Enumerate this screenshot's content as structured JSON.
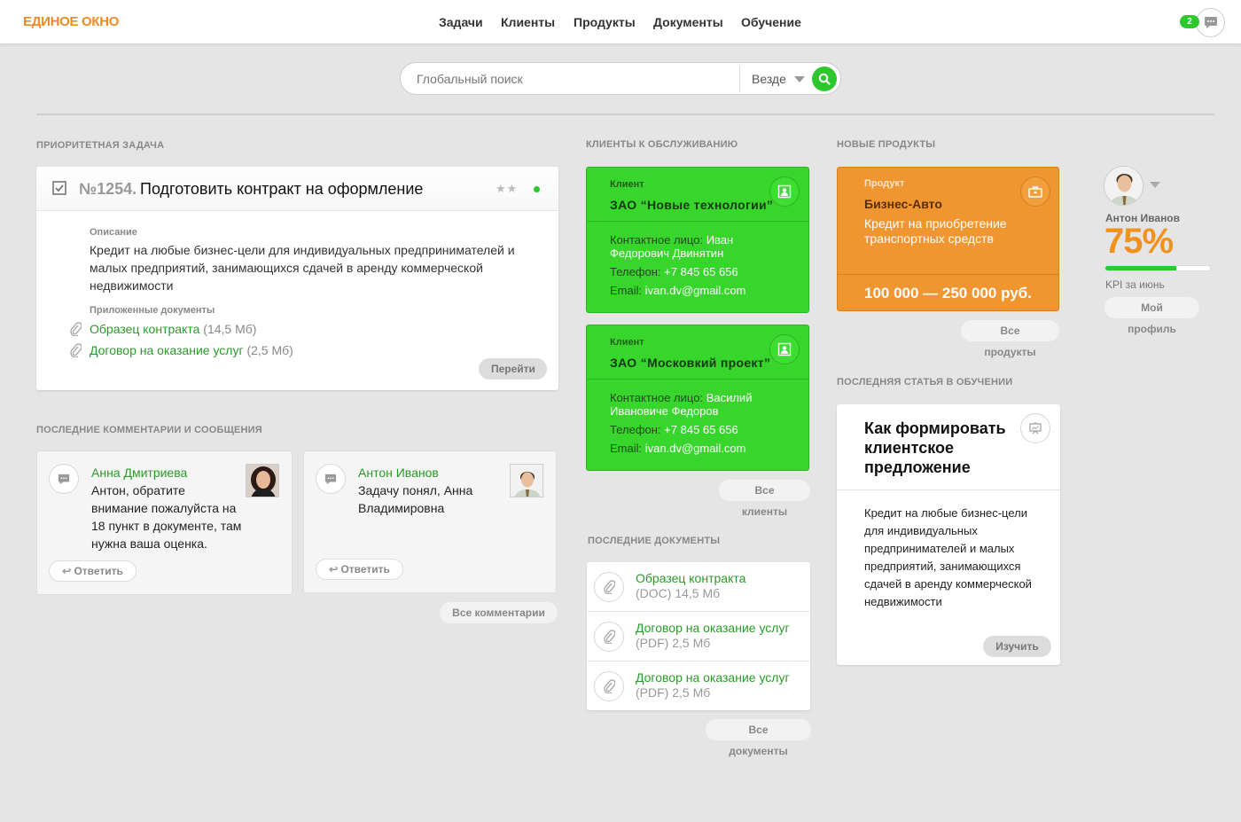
{
  "header": {
    "logo": "ЕДИНОЕ ОКНО",
    "nav": [
      "Задачи",
      "Клиенты",
      "Продукты",
      "Документы",
      "Обучение"
    ],
    "messages_count": "2"
  },
  "search": {
    "placeholder": "Глобальный поиск",
    "scope": "Везде"
  },
  "priority": {
    "section_title": "ПРИОРИТЕТНАЯ ЗАДАЧА",
    "number": "№1254.",
    "title": "Подготовить контракт на оформление",
    "desc_label": "Описание",
    "description": "Кредит на любые бизнес-цели для индивидуальных предпринимателей и малых предприятий, занимающихся сдачей в аренду коммерческой недвижимости",
    "docs_label": "Приложенные документы",
    "docs": [
      {
        "name": "Образец контракта",
        "size": "(14,5 Мб)"
      },
      {
        "name": "Договор на оказание услуг",
        "size": "(2,5 Мб)"
      }
    ],
    "go_button": "Перейти"
  },
  "comments": {
    "section_title": "ПОСЛЕДНИЕ КОММЕНТАРИИ И СООБЩЕНИЯ",
    "items": [
      {
        "author": "Анна Дмитриева",
        "text": "Антон, обратите внимание пожалуйста на 18 пункт в документе, там нужна ваша оценка.",
        "reply": "Ответить"
      },
      {
        "author": "Антон Иванов",
        "text": "Задачу понял, Анна Владимировна",
        "reply": "Ответить"
      }
    ],
    "all_button": "Все комментарии"
  },
  "clients": {
    "section_title": "КЛИЕНТЫ К ОБСЛУЖИВАНИЮ",
    "items": [
      {
        "label": "Клиент",
        "name": "ЗАО “Новые технологии”",
        "contact_label": "Контактное лицо:",
        "contact": "Иван Федорович Двинятин",
        "phone_label": "Телефон:",
        "phone": "+7 845 65 656",
        "email_label": "Email:",
        "email": "ivan.dv@gmail.com"
      },
      {
        "label": "Клиент",
        "name": "ЗАО “Московкий проект”",
        "contact_label": "Контактное лицо:",
        "contact": "Василий Ивановиче Федоров",
        "phone_label": "Телефон:",
        "phone": "+7 845 65 656",
        "email_label": "Email:",
        "email": "ivan.dv@gmail.com"
      }
    ],
    "all_button": "Все клиенты"
  },
  "documents": {
    "section_title": "ПОСЛЕДНИЕ ДОКУМЕНТЫ",
    "items": [
      {
        "name": "Образец контракта",
        "meta": "(DOC) 14,5 Мб"
      },
      {
        "name": "Договор на оказание услуг",
        "meta": "(PDF) 2,5 Мб"
      },
      {
        "name": "Договор на оказание услуг",
        "meta": "(PDF) 2,5 Мб"
      }
    ],
    "all_button": "Все документы"
  },
  "products": {
    "section_title": "НОВЫЕ ПРОДУКТЫ",
    "label": "Продукт",
    "name": "Бизнес-Авто",
    "description": "Кредит на приобретение транспортных средств",
    "price": "100 000 — 250 000 руб.",
    "all_button": "Все продукты"
  },
  "article": {
    "section_title": "ПОСЛЕДНЯЯ СТАТЬЯ В ОБУЧЕНИИ",
    "title": "Как формировать клиентское предложение",
    "text": "Кредит на любые бизнес-цели для индивидуальных предпринимателей и малых предприятий, занимающихся сдачей в аренду коммерческой недвижимости",
    "button": "Изучить"
  },
  "profile": {
    "name": "Антон Иванов",
    "kpi": "75%",
    "kpi_fraction": 0.68,
    "kpi_label": "KPI за июнь",
    "button": "Мой профиль"
  },
  "colors": {
    "accent_green": "#2ec72e",
    "client_green": "#38d62d",
    "product_orange": "#f09630",
    "logo_orange": "#ef8a22"
  }
}
